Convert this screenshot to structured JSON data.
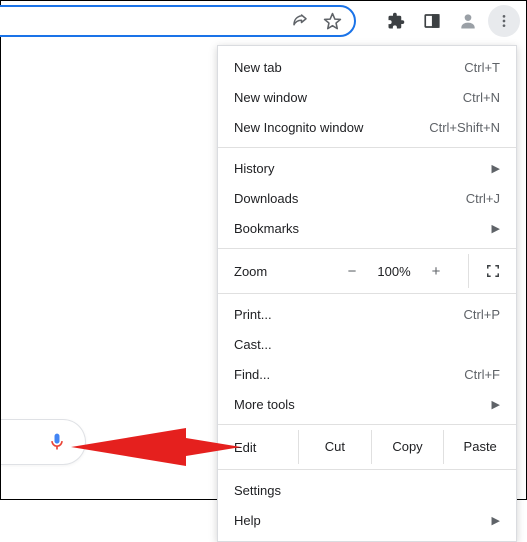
{
  "toolbar": {
    "icons": {
      "share": "share-icon",
      "star": "star-icon",
      "extensions": "extensions-icon",
      "sidepanel": "sidepanel-icon",
      "profile": "profile-icon",
      "menu": "kebab-menu-icon"
    }
  },
  "menu": {
    "new_tab": {
      "label": "New tab",
      "shortcut": "Ctrl+T"
    },
    "new_window": {
      "label": "New window",
      "shortcut": "Ctrl+N"
    },
    "new_incognito": {
      "label": "New Incognito window",
      "shortcut": "Ctrl+Shift+N"
    },
    "history": {
      "label": "History"
    },
    "downloads": {
      "label": "Downloads",
      "shortcut": "Ctrl+J"
    },
    "bookmarks": {
      "label": "Bookmarks"
    },
    "zoom": {
      "label": "Zoom",
      "minus": "−",
      "value": "100%",
      "plus": "+"
    },
    "print": {
      "label": "Print...",
      "shortcut": "Ctrl+P"
    },
    "cast": {
      "label": "Cast..."
    },
    "find": {
      "label": "Find...",
      "shortcut": "Ctrl+F"
    },
    "more_tools": {
      "label": "More tools"
    },
    "edit": {
      "label": "Edit",
      "cut": "Cut",
      "copy": "Copy",
      "paste": "Paste"
    },
    "settings": {
      "label": "Settings"
    },
    "help": {
      "label": "Help"
    }
  }
}
